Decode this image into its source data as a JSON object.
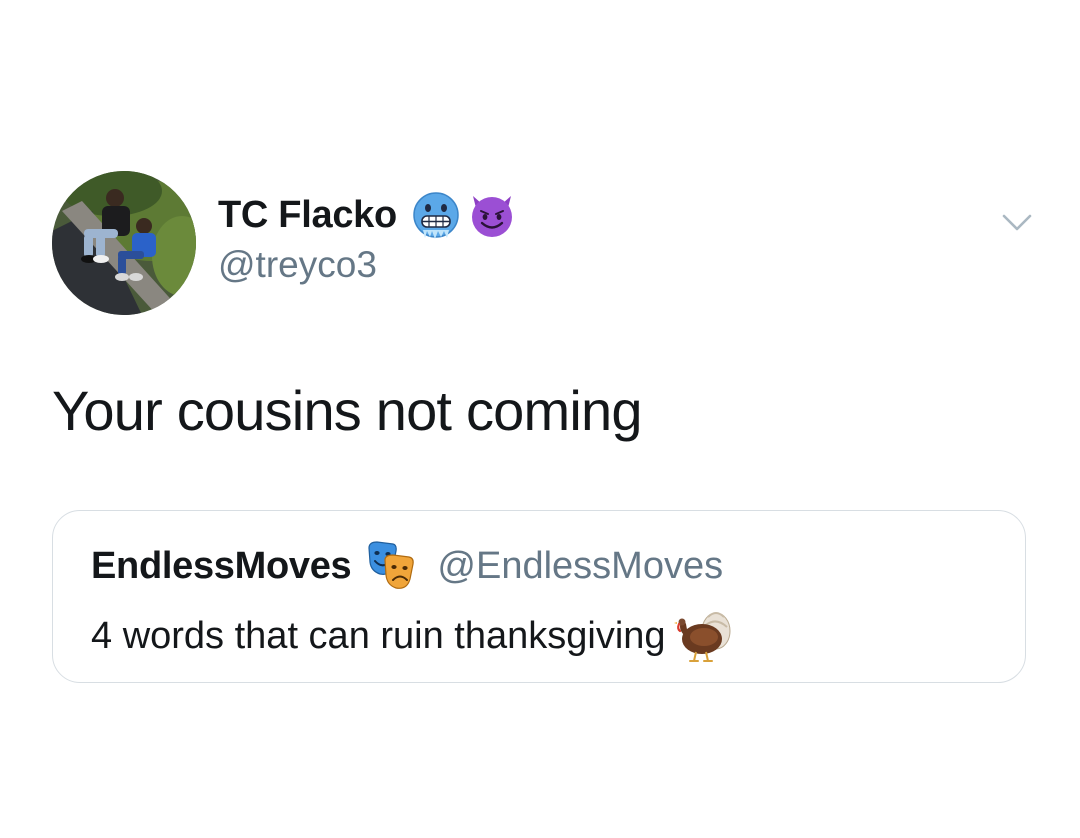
{
  "tweet": {
    "author": {
      "display_name": "TC Flacko",
      "handle": "@treyco3",
      "name_emojis": [
        "cold-face-emoji",
        "smiling-imp-emoji"
      ]
    },
    "text": "Your cousins not coming",
    "menu_icon": "chevron-down-icon",
    "quoted_tweet": {
      "display_name": "EndlessMoves",
      "name_emoji": "performing-arts-emoji",
      "handle": "@EndlessMoves",
      "text": "4 words that can ruin thanksgiving",
      "text_emoji": "turkey-emoji"
    }
  },
  "colors": {
    "text_primary": "#14171a",
    "text_secondary": "#657786",
    "border": "#d8dee3",
    "background": "#ffffff"
  }
}
